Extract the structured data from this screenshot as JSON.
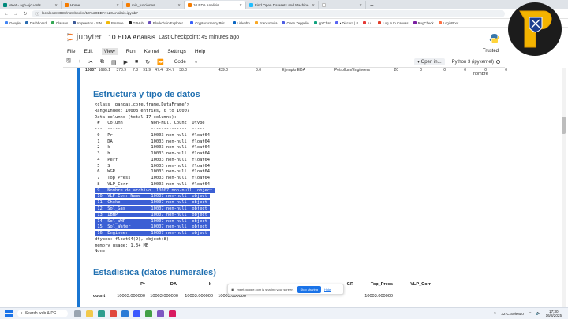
{
  "browser": {
    "tabs": [
      {
        "label": "Meet - agh-ojcu-mfs",
        "color": "#00897b",
        "active": false
      },
      {
        "label": "Home",
        "color": "#f57c00",
        "active": false
      },
      {
        "label": "mis_funciones",
        "color": "#f57c00",
        "active": false
      },
      {
        "label": "10 EDA Analisis",
        "color": "#f57c00",
        "active": true
      },
      {
        "label": "Find Open Datasets and Machine",
        "color": "#20beff",
        "active": false
      },
      {
        "label": "",
        "color": "#ffffff",
        "active": false
      }
    ],
    "new_tab": "+",
    "url": "localhost:8890/notebooks/10%20EDA%20Analisis.ipynb?"
  },
  "bookmarks": [
    "Google",
    "Dashboard",
    "Classes",
    "Impuestos - SIN",
    "Binance",
    "GitHub",
    "Blockchain Explorer...",
    "Cryptocurrency Pric...",
    "LinkedIn",
    "FrancoSvila",
    "Open Zeppelin",
    "gptChat",
    "• Discord | #",
    "ru...",
    "Log in to Canvas",
    "RugCheck",
    "LoginRoot"
  ],
  "jupyter": {
    "logo_word": "jupyter",
    "notebook_title": "10 EDA Analisis",
    "checkpoint": "Last Checkpoint: 49 minutes ago",
    "menu": [
      "File",
      "Edit",
      "View",
      "Run",
      "Kernel",
      "Settings",
      "Help"
    ],
    "trusted": "Trusted",
    "cell_type": "Code",
    "open_in": "Open in...",
    "kernel": "Python 3 (ipykernel)"
  },
  "toprow": {
    "index": "10007",
    "values": [
      "1695.1",
      "378.9",
      "7.8",
      "91.9",
      "47.4",
      "24.7",
      "38.0",
      "439.0",
      "8.0",
      "Ejemplo EDA",
      "Petrollum/Engineers",
      "20",
      "0",
      "0",
      "0",
      "0",
      "0"
    ],
    "trailing": "nombre"
  },
  "section1": {
    "title": "Estructura y tipo de datos",
    "info_lines": [
      "<class 'pandas.core.frame.DataFrame'>",
      "RangeIndex: 10008 entries, 0 to 10007",
      "Data columns (total 17 columns):",
      " #   Column           Non-Null Count  Dtype  ",
      "---  ------           --------------  -----  ",
      " 0   Pr               10003 non-null  float64",
      " 1   DA               10003 non-null  float64",
      " 2   k                10003 non-null  float64",
      " 3   h                10003 non-null  float64",
      " 4   Perf             10003 non-null  float64",
      " 5   S                10003 non-null  float64",
      " 6   WGR              10003 non-null  float64",
      " 7   Top_Press        10003 non-null  float64",
      " 8   VLP_Corr         10003 non-null  float64"
    ],
    "selected_lines": [
      " 9   Nombre de archivo  10007 non-null  object ",
      " 10  VLP_Corr_Name    10007 non-null  object ",
      " 11  Choke            10007 non-null  object ",
      " 12  Sol_Gas          10007 non-null  object ",
      " 13  IBHP             10007 non-null  object ",
      " 14  Sol_WHP          10007 non-null  object ",
      " 15  Sol_Water        10007 non-null  object ",
      " 16  Engineer         10007 non-null  object "
    ],
    "tail_lines": [
      "dtypes: float64(9), object(8)",
      "memory usage: 1.3+ MB",
      "None"
    ]
  },
  "section2": {
    "title": "Estadística (datos numerales)",
    "headers": [
      "Pr",
      "DA",
      "k",
      "",
      "",
      "",
      "",
      "GR",
      "Top_Press",
      "VLP_Corr"
    ],
    "row_label": "count",
    "row_values": [
      "10003.000000",
      "10003.000000",
      "10003.000000",
      "10003.000000",
      "",
      "",
      "",
      "",
      "10003.000000",
      ""
    ]
  },
  "share_banner": {
    "text": "meet.google.com is sharing your screen.",
    "stop": "Stop sharing",
    "hide": "Hide"
  },
  "taskbar": {
    "search": "Search web & PC",
    "weather": "32°C  Soleado",
    "time": "17:30",
    "date": "16/8/2025"
  }
}
